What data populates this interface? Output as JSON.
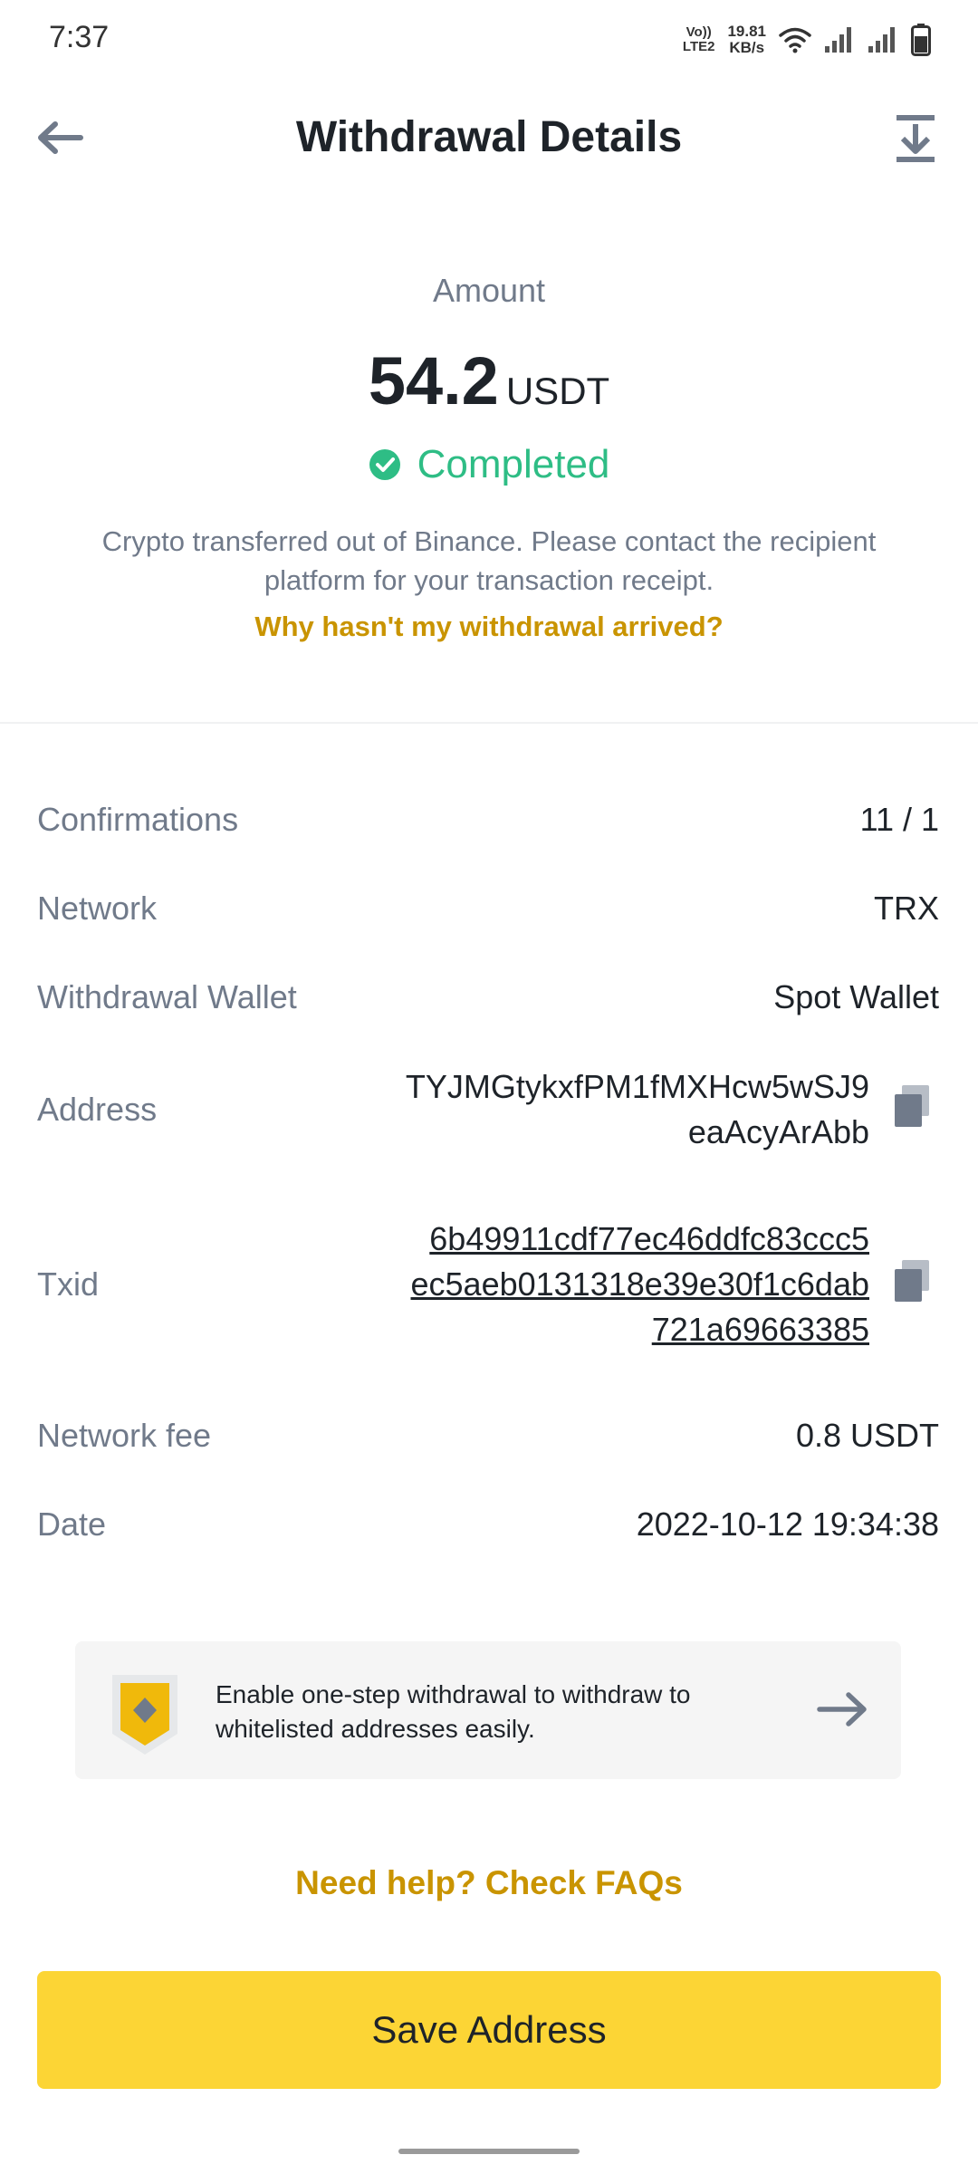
{
  "status_bar": {
    "time": "7:37",
    "network_top": "Vo))",
    "network_bottom": "LTE2",
    "speed_value": "19.81",
    "speed_unit": "KB/s",
    "icons": [
      "wifi-icon",
      "signal-icon",
      "signal-icon",
      "battery-icon"
    ]
  },
  "header": {
    "title": "Withdrawal Details",
    "back_icon": "arrow-left-icon",
    "download_icon": "download-icon"
  },
  "summary": {
    "amount_label": "Amount",
    "amount_value": "54.2",
    "amount_unit": "USDT",
    "status": "Completed",
    "status_icon": "check-circle-icon",
    "notice": "Crypto transferred out of Binance. Please contact the recipient platform for your transaction receipt.",
    "help_link": "Why hasn't my withdrawal arrived?"
  },
  "details": {
    "confirmations": {
      "label": "Confirmations",
      "value": "11 / 1"
    },
    "network": {
      "label": "Network",
      "value": "TRX"
    },
    "wallet": {
      "label": "Withdrawal Wallet",
      "value": "Spot Wallet"
    },
    "address": {
      "label": "Address",
      "lines": [
        "TYJMGtykxfPM1fMXHcw5wSJ9",
        "eaAcyArAbb"
      ],
      "copy_icon": "copy-icon"
    },
    "txid": {
      "label": "Txid",
      "lines": [
        "6b49911cdf77ec46ddfc83ccc5",
        "ec5aeb0131318e39e30f1c6dab",
        "721a69663385"
      ],
      "copy_icon": "copy-icon"
    },
    "fee": {
      "label": "Network fee",
      "value": "0.8 USDT"
    },
    "date": {
      "label": "Date",
      "value": "2022-10-12 19:34:38"
    }
  },
  "banner": {
    "text": "Enable one-step withdrawal to withdraw to whitelisted addresses easily.",
    "icon": "shield-icon",
    "arrow_icon": "arrow-right-icon"
  },
  "footer": {
    "faq_link": "Need help? Check FAQs",
    "save_button": "Save Address"
  },
  "colors": {
    "accent": "#fcd535",
    "link": "#c99400",
    "success": "#2ebd85",
    "muted": "#707a8a",
    "text": "#1e2329"
  }
}
